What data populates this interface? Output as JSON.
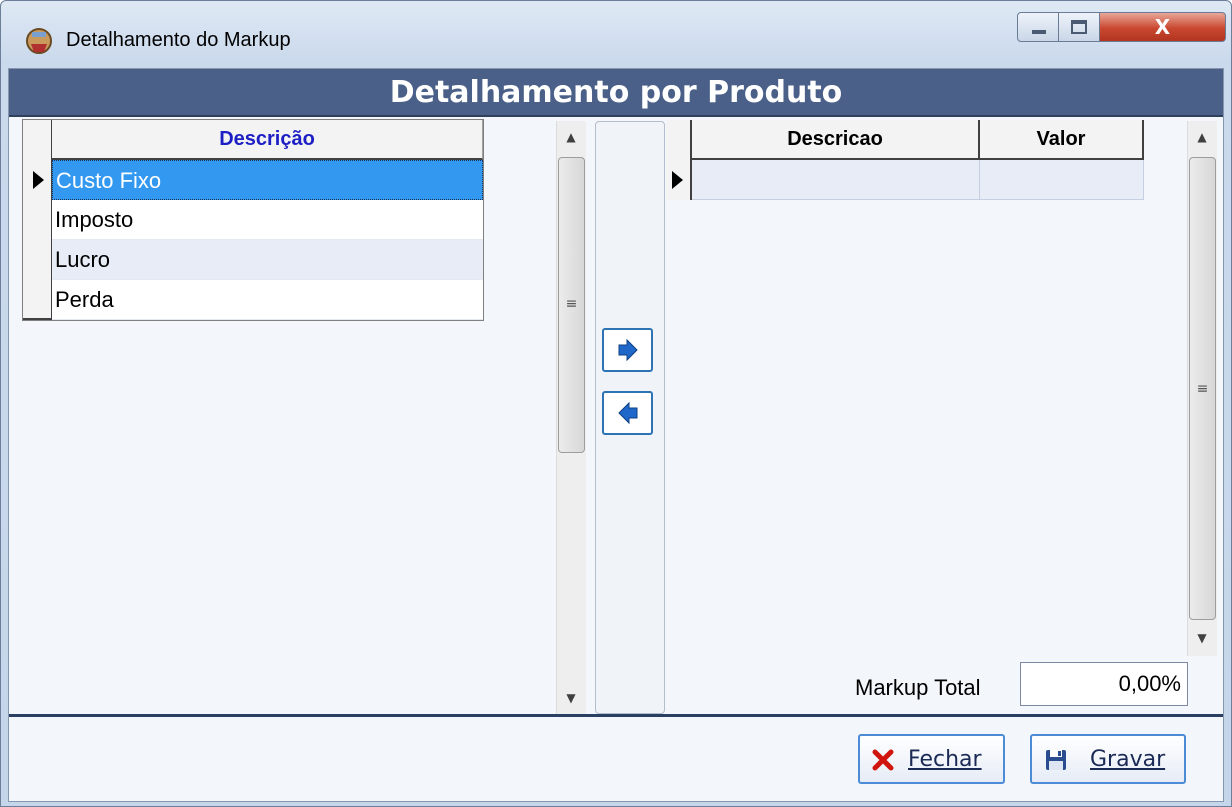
{
  "window": {
    "title": "Detalhamento do Markup",
    "controls": {
      "minimize": "minimize",
      "maximize": "maximize",
      "close": "X"
    }
  },
  "banner": {
    "title": "Detalhamento por Produto"
  },
  "left_grid": {
    "header": "Descrição",
    "rows": [
      "Custo Fixo",
      "Imposto",
      "Lucro",
      "Perda"
    ],
    "selected_index": 0
  },
  "transfer": {
    "add_icon": "arrow-right-icon",
    "remove_icon": "arrow-left-icon"
  },
  "right_grid": {
    "headers": {
      "descricao": "Descricao",
      "valor": "Valor"
    },
    "rows": [
      {
        "descricao": "",
        "valor": ""
      }
    ]
  },
  "markup_total": {
    "label": "Markup Total",
    "value": "0,00%"
  },
  "footer": {
    "close_button": {
      "label": "Fechar",
      "icon": "x-icon"
    },
    "save_button": {
      "label": "Gravar",
      "icon": "floppy-disk-icon"
    }
  },
  "colors": {
    "banner": "#4a6089",
    "selection": "#3398f0",
    "header_link": "#1d1fc4",
    "button_border": "#4c8bd6",
    "close_red": "#d0150f"
  }
}
